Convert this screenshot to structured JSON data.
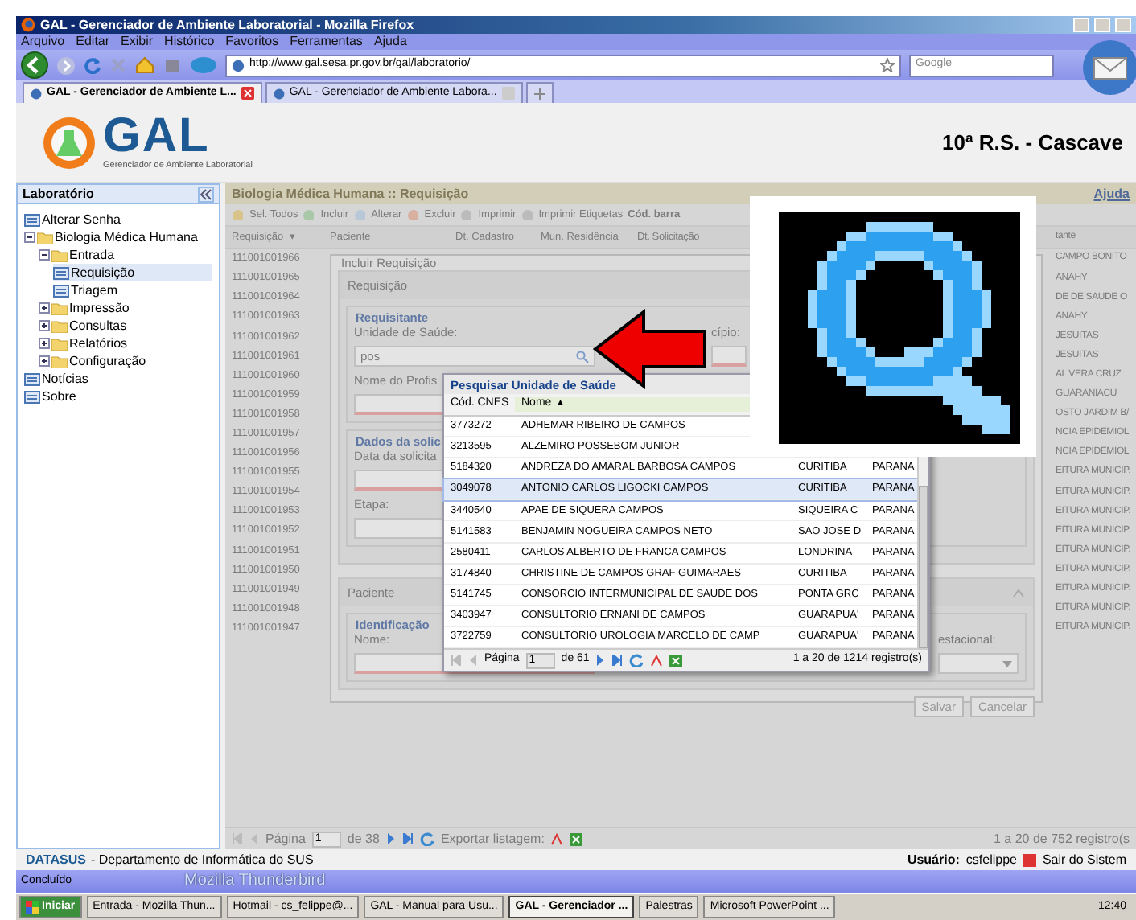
{
  "window": {
    "title": "GAL - Gerenciador de Ambiente Laboratorial - Mozilla Firefox"
  },
  "menu": [
    "Arquivo",
    "Editar",
    "Exibir",
    "Histórico",
    "Favoritos",
    "Ferramentas",
    "Ajuda"
  ],
  "address_bar": {
    "url": "http://www.gal.sesa.pr.gov.br/gal/laboratorio/"
  },
  "search_bar": {
    "placeholder": "Google"
  },
  "tabs": [
    {
      "label": "GAL - Gerenciador de Ambiente L...",
      "selected": true
    },
    {
      "label": "GAL - Gerenciador de Ambiente Labora...",
      "selected": false
    }
  ],
  "header": {
    "logo": "GAL",
    "logo_subtitle": "Gerenciador de Ambiente Laboratorial",
    "region": "10ª R.S. - Cascave"
  },
  "sidebar": {
    "title": "Laboratório",
    "items": [
      {
        "label": "Alterar Senha",
        "kind": "page",
        "selected": false
      },
      {
        "label": "Biologia Médica Humana",
        "kind": "folder",
        "expanded": true,
        "selected": false,
        "children": [
          {
            "label": "Entrada",
            "kind": "folder",
            "expanded": true,
            "selected": false,
            "children": [
              {
                "label": "Requisição",
                "kind": "page",
                "selected": true
              },
              {
                "label": "Triagem",
                "kind": "page",
                "selected": false
              }
            ]
          },
          {
            "label": "Impressão",
            "kind": "folder",
            "expanded": false,
            "selected": false
          },
          {
            "label": "Consultas",
            "kind": "folder",
            "expanded": false,
            "selected": false
          },
          {
            "label": "Relatórios",
            "kind": "folder",
            "expanded": false,
            "selected": false
          },
          {
            "label": "Configuração",
            "kind": "folder",
            "expanded": false,
            "selected": false
          }
        ]
      },
      {
        "label": "Notícias",
        "kind": "page",
        "selected": false
      },
      {
        "label": "Sobre",
        "kind": "page",
        "selected": false
      }
    ]
  },
  "panel": {
    "title": "Biologia Médica Humana :: Requisição",
    "help": "Ajuda",
    "toolbar": [
      "Sel. Todos",
      "Incluir",
      "Alterar",
      "Excluir",
      "Imprimir",
      "Imprimir Etiquetas",
      "Cód. barra"
    ]
  },
  "grid": {
    "columns": [
      {
        "label": "Requisição",
        "sort_arrow": "▾"
      },
      {
        "label": "Paciente"
      },
      {
        "label": "Dt. Cadastro"
      },
      {
        "label": "Mun. Residência"
      },
      {
        "label": "Dt. Solicitação"
      },
      {
        "label": "tante"
      }
    ],
    "rows": [
      {
        "column_1": "111001001966",
        "column_6": "CAMPO BONITO"
      },
      {
        "column_1": "111001001965",
        "column_6": "ANAHY"
      },
      {
        "column_1": "111001001964",
        "column_6": "DE DE SAUDE O"
      },
      {
        "column_1": "111001001963",
        "column_6": "ANAHY"
      },
      {
        "column_1": "111001001962",
        "column_6": "JESUITAS"
      },
      {
        "column_1": "111001001961",
        "column_6": "JESUITAS"
      },
      {
        "column_1": "111001001960",
        "column_6": "AL VERA CRUZ"
      },
      {
        "column_1": "111001001959",
        "column_6": "GUARANIACU"
      },
      {
        "column_1": "111001001958",
        "column_6": "OSTO JARDIM B/"
      },
      {
        "column_1": "111001001957",
        "column_6": "NCIA EPIDEMIOL"
      },
      {
        "column_1": "111001001956",
        "column_6": "NCIA EPIDEMIOL"
      },
      {
        "column_1": "111001001955",
        "column_6": "EITURA MUNICIP."
      },
      {
        "column_1": "111001001954",
        "column_6": "EITURA MUNICIP."
      },
      {
        "column_1": "111001001953",
        "column_6": "EITURA MUNICIP."
      },
      {
        "column_1": "111001001952",
        "column_6": "EITURA MUNICIP."
      },
      {
        "column_1": "111001001951",
        "column_6": "EITURA MUNICIP."
      },
      {
        "column_1": "111001001950",
        "column_6": "EITURA MUNICIP."
      },
      {
        "column_1": "111001001949",
        "column_6": "EITURA MUNICIP."
      },
      {
        "column_1": "111001001948",
        "column_6": "EITURA MUNICIP."
      },
      {
        "column_1": "111001001947",
        "column_6": "EITURA MUNICIP."
      }
    ],
    "pager": {
      "label": "Página",
      "page": "1",
      "of": "de 38",
      "export": "Exportar listagem:",
      "count": "1 a 20 de 752 registro(s"
    }
  },
  "dialog": {
    "title": "Incluir Requisição",
    "section_1": "Requisição",
    "requisitante": {
      "legend": "Requisitante",
      "unit_label": "Unidade de Saúde:",
      "unit_value": "pos",
      "municipio_label": "cípio:",
      "professional_label": "Nome do Profis"
    },
    "request_data": {
      "legend": "Dados da solic",
      "date_label": "Data da solicita",
      "stage_label": "Etapa:"
    },
    "section_2": "Paciente",
    "identification": {
      "legend": "Identificação",
      "name_label": "Nome:",
      "gestational_label": "estacional:"
    },
    "buttons": [
      "Salvar",
      "Cancelar"
    ]
  },
  "popup": {
    "title": "Pesquisar Unidade de Saúde",
    "columns": [
      {
        "label": "Cód. CNES"
      },
      {
        "label": "Nome",
        "sort_arrow": "▴"
      }
    ],
    "rows": [
      {
        "cnes": "3773272",
        "name": "ADHEMAR RIBEIRO DE CAMPOS",
        "selected": false
      },
      {
        "cnes": "3213595",
        "name": "ALZEMIRO POSSEBOM JUNIOR",
        "selected": false
      },
      {
        "cnes": "5184320",
        "name": "ANDREZA DO AMARAL BARBOSA CAMPOS",
        "city": "CURITIBA",
        "state": "PARANA",
        "selected": false
      },
      {
        "cnes": "3049078",
        "name": "ANTONIO CARLOS LIGOCKI CAMPOS",
        "city": "CURITIBA",
        "state": "PARANA",
        "selected": true
      },
      {
        "cnes": "3440540",
        "name": "APAE DE SIQUERA CAMPOS",
        "city": "SIQUEIRA C",
        "state": "PARANA",
        "selected": false
      },
      {
        "cnes": "5141583",
        "name": "BENJAMIN NOGUEIRA CAMPOS NETO",
        "city": "SAO JOSE D",
        "state": "PARANA",
        "selected": false
      },
      {
        "cnes": "2580411",
        "name": "CARLOS ALBERTO DE FRANCA CAMPOS",
        "city": "LONDRINA",
        "state": "PARANA",
        "selected": false
      },
      {
        "cnes": "3174840",
        "name": "CHRISTINE DE CAMPOS GRAF GUIMARAES",
        "city": "CURITIBA",
        "state": "PARANA",
        "selected": false
      },
      {
        "cnes": "5141745",
        "name": "CONSORCIO INTERMUNICIPAL DE SAUDE DOS",
        "city": "PONTA GRC",
        "state": "PARANA",
        "selected": false
      },
      {
        "cnes": "3403947",
        "name": "CONSULTORIO ERNANI DE CAMPOS",
        "city": "GUARAPUA'",
        "state": "PARANA",
        "selected": false
      },
      {
        "cnes": "3722759",
        "name": "CONSULTORIO UROLOGIA MARCELO DE CAMP",
        "city": "GUARAPUA'",
        "state": "PARANA",
        "selected": false
      }
    ],
    "pager": {
      "label": "Página",
      "page": "1",
      "of": "de 61",
      "count": "1 a 20 de 1214 registro(s)"
    }
  },
  "footer": {
    "org": "DATASUS",
    "org_desc": "- Departamento de Informática do SUS",
    "user_label": "Usuário:",
    "user": "csfelippe",
    "logout": "Sair do Sistem"
  },
  "status_bar": {
    "text": "Concluído",
    "notice": "Mozilla Thunderbird"
  },
  "taskbar": {
    "start": "Iniciar",
    "items": [
      {
        "label": "Entrada - Mozilla Thun...",
        "selected": false
      },
      {
        "label": "Hotmail - cs_felippe@...",
        "selected": false
      },
      {
        "label": "GAL - Manual para Usu...",
        "selected": false
      },
      {
        "label": "GAL - Gerenciador ...",
        "selected": true
      },
      {
        "label": "Palestras",
        "selected": false
      },
      {
        "label": "Microsoft PowerPoint ...",
        "selected": false
      }
    ],
    "clock": "12:40"
  }
}
